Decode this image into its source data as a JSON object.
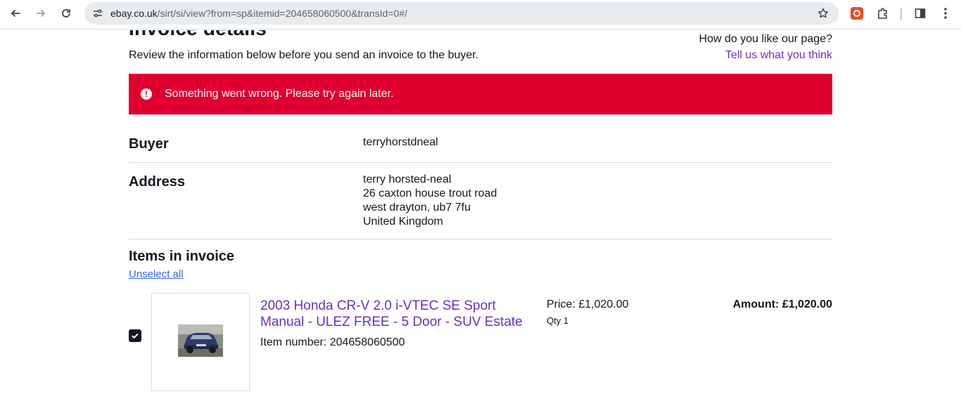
{
  "browser": {
    "url_host": "ebay.co.uk",
    "url_path": "/sirt/si/view?from=sp&itemid=204658060500&transId=0#/"
  },
  "header": {
    "title": "Invoice details",
    "intro": "Review the information below before you send an invoice to the buyer.",
    "feedback_question": "How do you like our page?",
    "feedback_link": "Tell us what you think"
  },
  "alert": {
    "message": "Something went wrong. Please try again later.",
    "color": "#e0002f"
  },
  "buyer": {
    "label": "Buyer",
    "value": "terryhorstdneal"
  },
  "address": {
    "label": "Address",
    "lines": [
      "terry horsted-neal",
      "26 caxton house trout road",
      "west drayton, ub7 7fu",
      "United Kingdom"
    ]
  },
  "items": {
    "title": "Items in invoice",
    "unselect_label": "Unselect all",
    "list": [
      {
        "checked": true,
        "title": "2003 Honda CR-V 2.0 i-VTEC SE Sport Manual - ULEZ FREE - 5 Door - SUV Estate",
        "item_number": "Item number: 204658060500",
        "price": "Price: £1,020.00",
        "qty": "Qty 1",
        "amount": "Amount: £1,020.00"
      }
    ]
  },
  "colors": {
    "link_purple": "#6c2fbf",
    "link_blue": "#3665f3"
  }
}
